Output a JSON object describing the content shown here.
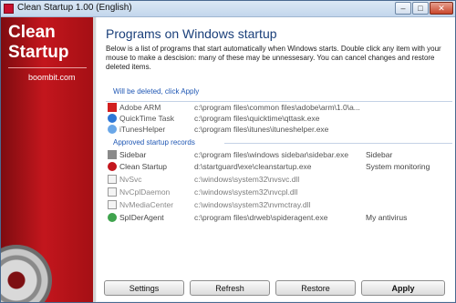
{
  "window": {
    "title": "Clean Startup 1.00 (English)",
    "min_label": "–",
    "max_label": "□",
    "close_label": "✕"
  },
  "sidebar": {
    "brand_line1": "Clean",
    "brand_line2": "Startup",
    "site": "boombit.com"
  },
  "main": {
    "title": "Programs on Windows startup",
    "description": "Below is a list of programs that start automatically when Windows starts. Double click any item with your mouse to make a descision: many of these may be unnessesary. You can cancel changes and restore deleted items."
  },
  "groups": {
    "deleted_label": "Will be deleted, click Apply",
    "approved_label": "Approved startup records"
  },
  "deleted_items": [
    {
      "name": "Adobe ARM",
      "path": "c:\\program files\\common files\\adobe\\arm\\1.0\\a...",
      "note": ""
    },
    {
      "name": "QuickTime Task",
      "path": "c:\\program files\\quicktime\\qttask.exe",
      "note": ""
    },
    {
      "name": "iTunesHelper",
      "path": "c:\\program files\\itunes\\ituneshelper.exe",
      "note": ""
    }
  ],
  "approved_items": [
    {
      "name": "Sidebar",
      "path": "c:\\program files\\windows sidebar\\sidebar.exe",
      "note": "Sidebar"
    },
    {
      "name": "Clean Startup",
      "path": "d:\\startguard\\exe\\cleanstartup.exe",
      "note": "System monitoring"
    },
    {
      "name": "NvSvc",
      "path": "c:\\windows\\system32\\nvsvc.dll",
      "note": ""
    },
    {
      "name": "NvCplDaemon",
      "path": "c:\\windows\\system32\\nvcpl.dll",
      "note": ""
    },
    {
      "name": "NvMediaCenter",
      "path": "c:\\windows\\system32\\nvmctray.dll",
      "note": ""
    },
    {
      "name": "SpIDerAgent",
      "path": "c:\\program files\\drweb\\spideragent.exe",
      "note": "My antivirus"
    }
  ],
  "buttons": {
    "settings": "Settings",
    "refresh": "Refresh",
    "restore": "Restore",
    "apply": "Apply"
  },
  "colors": {
    "brand_red": "#c3161d",
    "title_blue": "#1a3f7a",
    "group_blue": "#1f57b4"
  }
}
